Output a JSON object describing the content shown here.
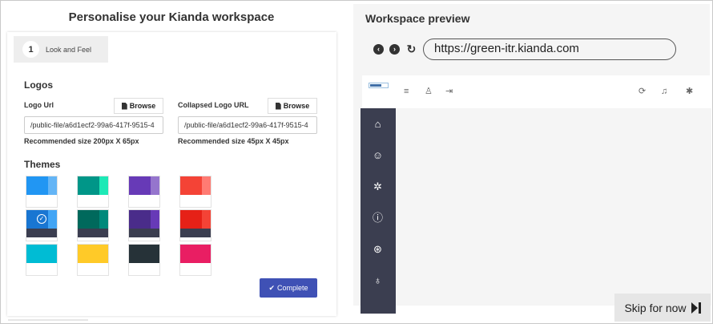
{
  "left": {
    "title": "Personalise your Kianda workspace",
    "step": {
      "number": "1",
      "label": "Look and Feel"
    },
    "logos": {
      "heading": "Logos",
      "logo_url": {
        "label": "Logo Url",
        "browse_label": "Browse",
        "value": "/public-file/a6d1ecf2-99a6-417f-9515-4",
        "hint": "Recommended size 200px X 65px"
      },
      "collapsed_logo_url": {
        "label": "Collapsed Logo URL",
        "browse_label": "Browse",
        "value": "/public-file/a6d1ecf2-99a6-417f-9515-4",
        "hint": "Recommended size 45px X 45px"
      }
    },
    "themes": {
      "heading": "Themes",
      "selected_index": 4,
      "swatches": [
        {
          "primary": "#2196f3",
          "secondary": "#64b5f6",
          "dark": false
        },
        {
          "primary": "#009688",
          "secondary": "#1de9b6",
          "dark": false
        },
        {
          "primary": "#673ab7",
          "secondary": "#9575cd",
          "dark": false
        },
        {
          "primary": "#f44336",
          "secondary": "#ff7b73",
          "dark": false
        },
        {
          "primary": "#1976d2",
          "secondary": "#42a5f5",
          "dark": true
        },
        {
          "primary": "#00695c",
          "secondary": "#00897b",
          "dark": true
        },
        {
          "primary": "#4a2c8a",
          "secondary": "#673ab7",
          "dark": true
        },
        {
          "primary": "#e62117",
          "secondary": "#f44336",
          "dark": true
        },
        {
          "primary": "#00bcd4",
          "secondary": "#00bcd4",
          "dark": false
        },
        {
          "primary": "#ffca28",
          "secondary": "#ffca28",
          "dark": false
        },
        {
          "primary": "#263238",
          "secondary": "#263238",
          "dark": false
        },
        {
          "primary": "#e91e63",
          "secondary": "#e91e63",
          "dark": false
        }
      ]
    },
    "complete_label": "Complete"
  },
  "right": {
    "title": "Workspace preview",
    "url": "https://green-itr.kianda.com",
    "header_icons": [
      "menu-icon",
      "user-icon",
      "logout-icon",
      "refresh-icon",
      "bell-icon",
      "gear-icon"
    ],
    "sidebar_icons": [
      "home-icon",
      "users-icon",
      "settings-icon",
      "info-icon",
      "support-icon",
      "lightbulb-icon"
    ],
    "sidebar_color": "#3b3e50"
  },
  "skip_label": "Skip for now"
}
